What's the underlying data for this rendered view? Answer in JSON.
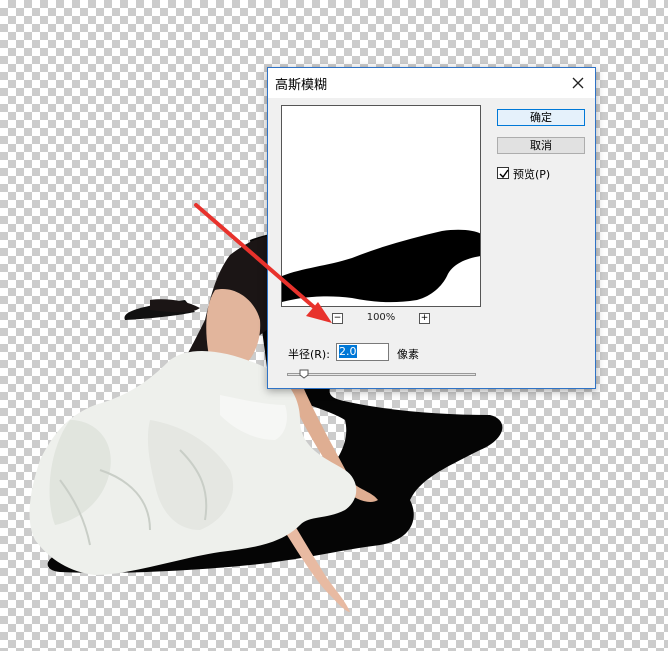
{
  "dialog": {
    "title": "高斯模糊",
    "ok_label": "确定",
    "cancel_label": "取消",
    "preview_label": "预览(P)",
    "preview_checked": true,
    "zoom_level": "100%",
    "zoom_out_symbol": "−",
    "zoom_in_symbol": "+",
    "radius_label": "半径(R):",
    "radius_value": "2.0",
    "radius_unit": "像素"
  },
  "colors": {
    "accent": "#2f73c6",
    "annotation_arrow": "#e8322c"
  },
  "icons": [
    "close-icon",
    "zoom-out-icon",
    "zoom-in-icon",
    "check-icon",
    "slider-thumb-icon"
  ]
}
